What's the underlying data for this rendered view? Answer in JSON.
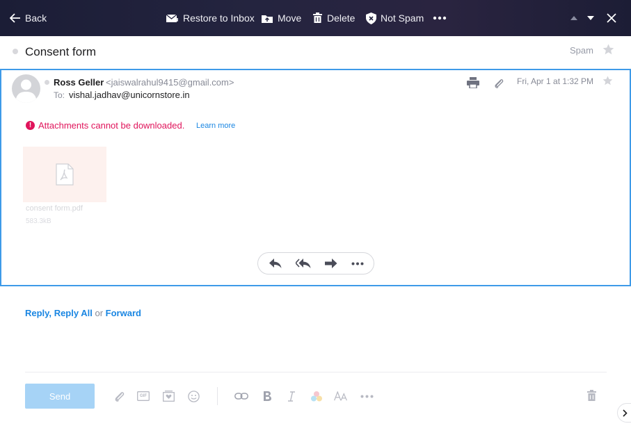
{
  "toolbar": {
    "back_label": "Back",
    "restore_label": "Restore to Inbox",
    "move_label": "Move",
    "delete_label": "Delete",
    "not_spam_label": "Not Spam"
  },
  "message": {
    "subject": "Consent form",
    "folder": "Spam",
    "sender_name": "Ross Geller",
    "sender_email": "<jaiswalrahul9415@gmail.com>",
    "to_label": "To:",
    "to_value": "vishal.jadhav@unicornstore.in",
    "date": "Fri, Apr 1 at 1:32 PM",
    "warning": "Attachments cannot be downloaded.",
    "learn_more": "Learn more",
    "attachment": {
      "name": "consent form.pdf",
      "size": "583.3kB"
    }
  },
  "reply": {
    "reply": "Reply,",
    "reply_all": "Reply All",
    "or": "or",
    "forward": "Forward"
  },
  "compose": {
    "send_label": "Send",
    "gif_label": "GIF"
  },
  "colors": {
    "accent": "#1a86e2",
    "card_border": "#3e9ae8",
    "warning": "#e0145b",
    "send_disabled": "#a6d3f6"
  }
}
